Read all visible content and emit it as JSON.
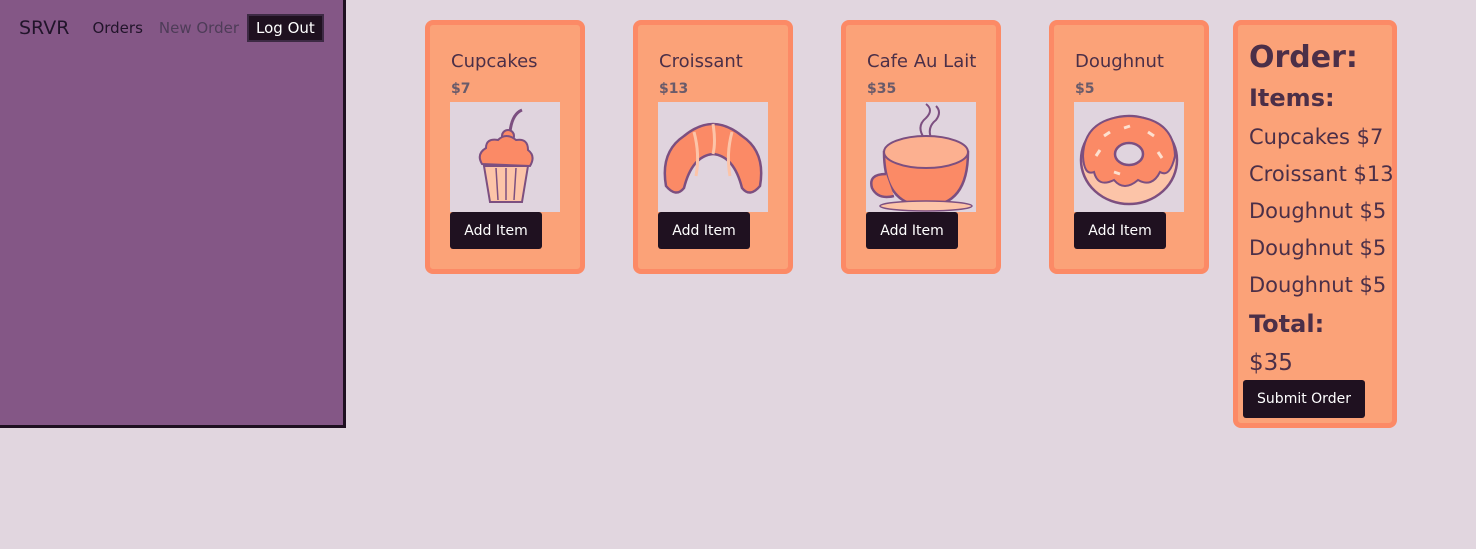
{
  "nav": {
    "brand": "SRVR",
    "orders": "Orders",
    "new_order": "New Order",
    "logout": "Log Out"
  },
  "products": [
    {
      "name": "Cupcakes",
      "price": "$7",
      "icon": "cupcake-icon",
      "button": "Add Item"
    },
    {
      "name": "Croissant",
      "price": "$13",
      "icon": "croissant-icon",
      "button": "Add Item"
    },
    {
      "name": "Cafe Au Lait",
      "price": "$35",
      "icon": "coffee-cup-icon",
      "button": "Add Item"
    },
    {
      "name": "Doughnut",
      "price": "$5",
      "icon": "doughnut-icon",
      "button": "Add Item"
    }
  ],
  "order": {
    "title": "Order:",
    "items_label": "Items:",
    "items": [
      "Cupcakes $7",
      "Croissant $13",
      "Doughnut $5",
      "Doughnut $5",
      "Doughnut $5"
    ],
    "total_label": "Total:",
    "total": "$35",
    "submit": "Submit Order"
  },
  "colors": {
    "background": "#e1d6df",
    "sidebar": "#845786",
    "card": "#fba278",
    "card_border": "#fc8a66",
    "button": "#1f1120"
  }
}
